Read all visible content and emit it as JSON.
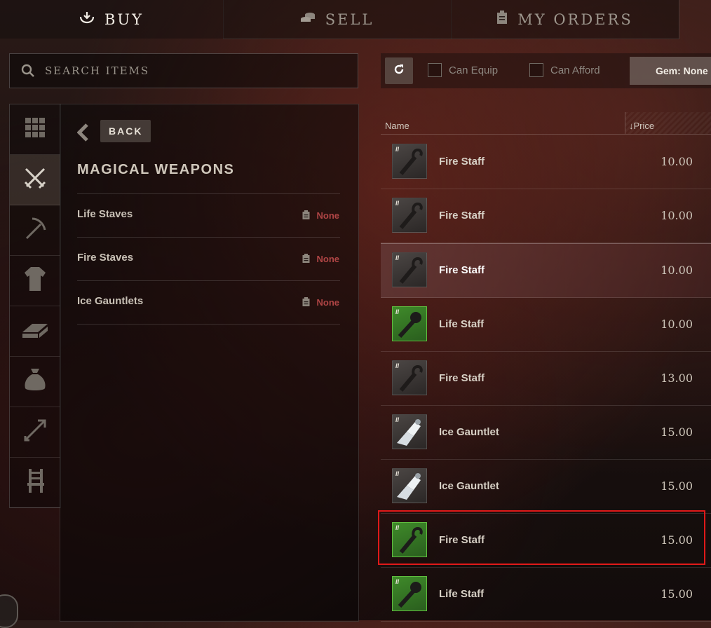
{
  "tabs": [
    {
      "label": "BUY",
      "icon": "buy-icon",
      "active": true
    },
    {
      "label": "SELL",
      "icon": "coins-icon",
      "active": false
    },
    {
      "label": "MY ORDERS",
      "icon": "clipboard-icon",
      "active": false
    }
  ],
  "search": {
    "placeholder": "SEARCH ITEMS"
  },
  "categories": [
    {
      "name": "all-items",
      "icon": "grid-icon",
      "active": false
    },
    {
      "name": "weapons",
      "icon": "crossed-swords-icon",
      "active": true
    },
    {
      "name": "tools",
      "icon": "pickaxe-icon",
      "active": false
    },
    {
      "name": "armor",
      "icon": "shirt-icon",
      "active": false
    },
    {
      "name": "resources",
      "icon": "ingot-icon",
      "active": false
    },
    {
      "name": "consumables",
      "icon": "pouch-icon",
      "active": false
    },
    {
      "name": "ammunition",
      "icon": "arrow-icon",
      "active": false
    },
    {
      "name": "furniture",
      "icon": "chair-icon",
      "active": false
    }
  ],
  "back_label": "BACK",
  "section_title": "MAGICAL WEAPONS",
  "subcategories": [
    {
      "label": "Life Staves",
      "status": "None"
    },
    {
      "label": "Fire Staves",
      "status": "None"
    },
    {
      "label": "Ice Gauntlets",
      "status": "None"
    }
  ],
  "filters": {
    "can_equip": "Can Equip",
    "can_afford": "Can Afford",
    "gem": "Gem: None"
  },
  "columns": {
    "name": "Name",
    "price": "Price"
  },
  "sort_indicator": "↓",
  "tier_mark": "II",
  "listings": [
    {
      "name": "Fire Staff",
      "price": "10.00",
      "thumb": "fire-staff-icon",
      "rarity": "common"
    },
    {
      "name": "Fire Staff",
      "price": "10.00",
      "thumb": "fire-staff-icon",
      "rarity": "common"
    },
    {
      "name": "Fire Staff",
      "price": "10.00",
      "thumb": "fire-staff-icon",
      "rarity": "common"
    },
    {
      "name": "Life Staff",
      "price": "10.00",
      "thumb": "life-staff-icon",
      "rarity": "uncommon"
    },
    {
      "name": "Fire Staff",
      "price": "13.00",
      "thumb": "fire-staff-icon",
      "rarity": "common"
    },
    {
      "name": "Ice Gauntlet",
      "price": "15.00",
      "thumb": "ice-gauntlet-icon",
      "rarity": "common"
    },
    {
      "name": "Ice Gauntlet",
      "price": "15.00",
      "thumb": "ice-gauntlet-icon",
      "rarity": "common"
    },
    {
      "name": "Fire Staff",
      "price": "15.00",
      "thumb": "fire-staff-icon",
      "rarity": "uncommon"
    },
    {
      "name": "Life Staff",
      "price": "15.00",
      "thumb": "life-staff-icon",
      "rarity": "uncommon"
    }
  ],
  "colors": {
    "accent_red": "#e01919",
    "status_none": "#b04545",
    "uncommon_green": "#5fbf3f"
  }
}
